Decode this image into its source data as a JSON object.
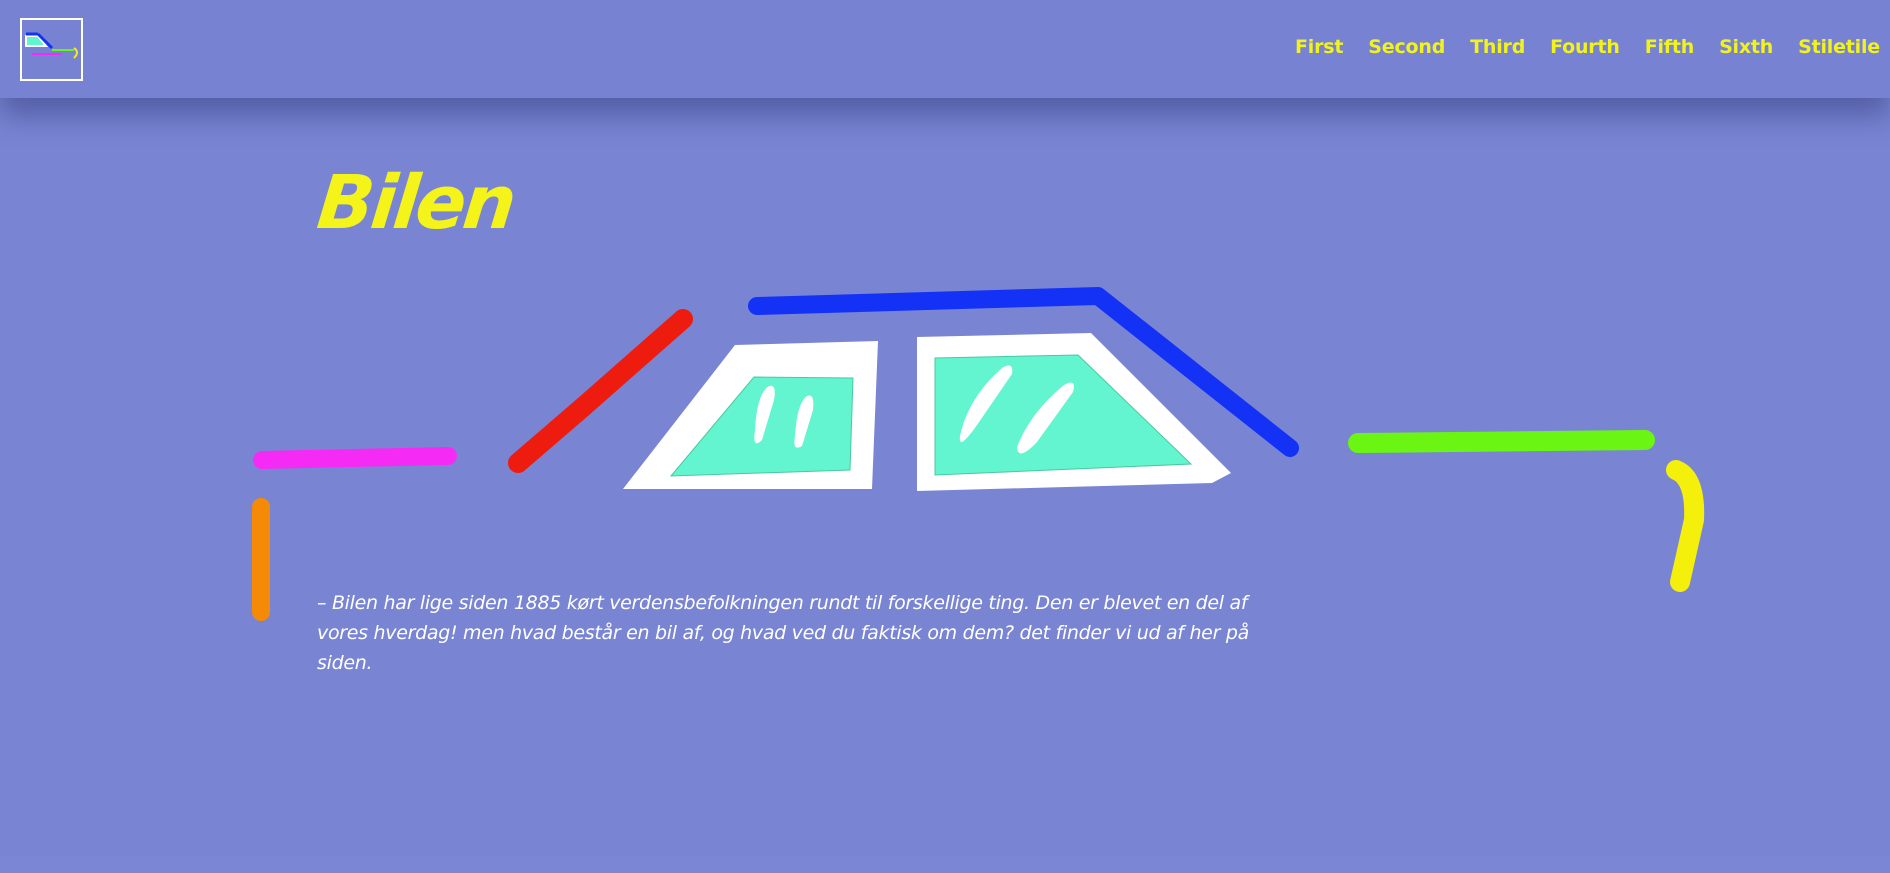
{
  "nav": {
    "logo_alt": "logo",
    "links": [
      "First",
      "Second",
      "Third",
      "Fourth",
      "Fifth",
      "Sixth",
      "Stiletile"
    ]
  },
  "hero": {
    "title": "Bilen",
    "intro": "– Bilen har lige siden 1885 kørt verdensbefolkningen rundt til forskellige ting. Den er blevet en del af vores hverdag! men hvad består en bil af, og hvad ved du faktisk om dem? det finder vi ud af her på siden."
  },
  "colors": {
    "background": "#7985d3",
    "accent_yellow": "#f4f41a",
    "window_fill": "#63f5cf",
    "roof_blue": "#1432f5",
    "hood_red": "#ee1c0e",
    "bumper_magenta": "#f52af5",
    "bumper_orange": "#f58a06",
    "trunk_green": "#6af512",
    "tail_yellow": "#f5ef0c"
  }
}
